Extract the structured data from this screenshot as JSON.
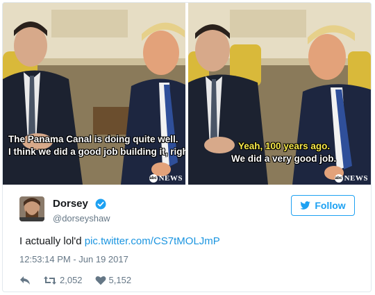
{
  "media": {
    "left_caption_line1": "The Panama Canal is doing quite well.",
    "left_caption_line2": "I think we did a good job building it, right?",
    "right_caption_line1": "Yeah, 100 years ago.",
    "right_caption_line2": "We did a very good job.",
    "watermark_prefix": "abc",
    "watermark": "NEWS"
  },
  "author": {
    "name": "Dorsey",
    "handle": "@dorseyshaw",
    "verified": true,
    "avatar_icon": "avatar-photo"
  },
  "follow_button": {
    "label": "Follow",
    "icon": "twitter-bird-icon"
  },
  "tweet": {
    "text": "I actually lol'd ",
    "link": "pic.twitter.com/CS7tMOLJmP",
    "timestamp": "12:53:14 PM - Jun 19 2017"
  },
  "actions": {
    "reply_icon": "reply-icon",
    "retweet_icon": "retweet-icon",
    "retweet_count": "2,052",
    "like_icon": "heart-icon",
    "like_count": "5,152"
  },
  "colors": {
    "accent": "#1da1f2",
    "link": "#1b95e0",
    "muted": "#657786",
    "caption_white": "#ffffff",
    "caption_yellow": "#f7e94a"
  }
}
